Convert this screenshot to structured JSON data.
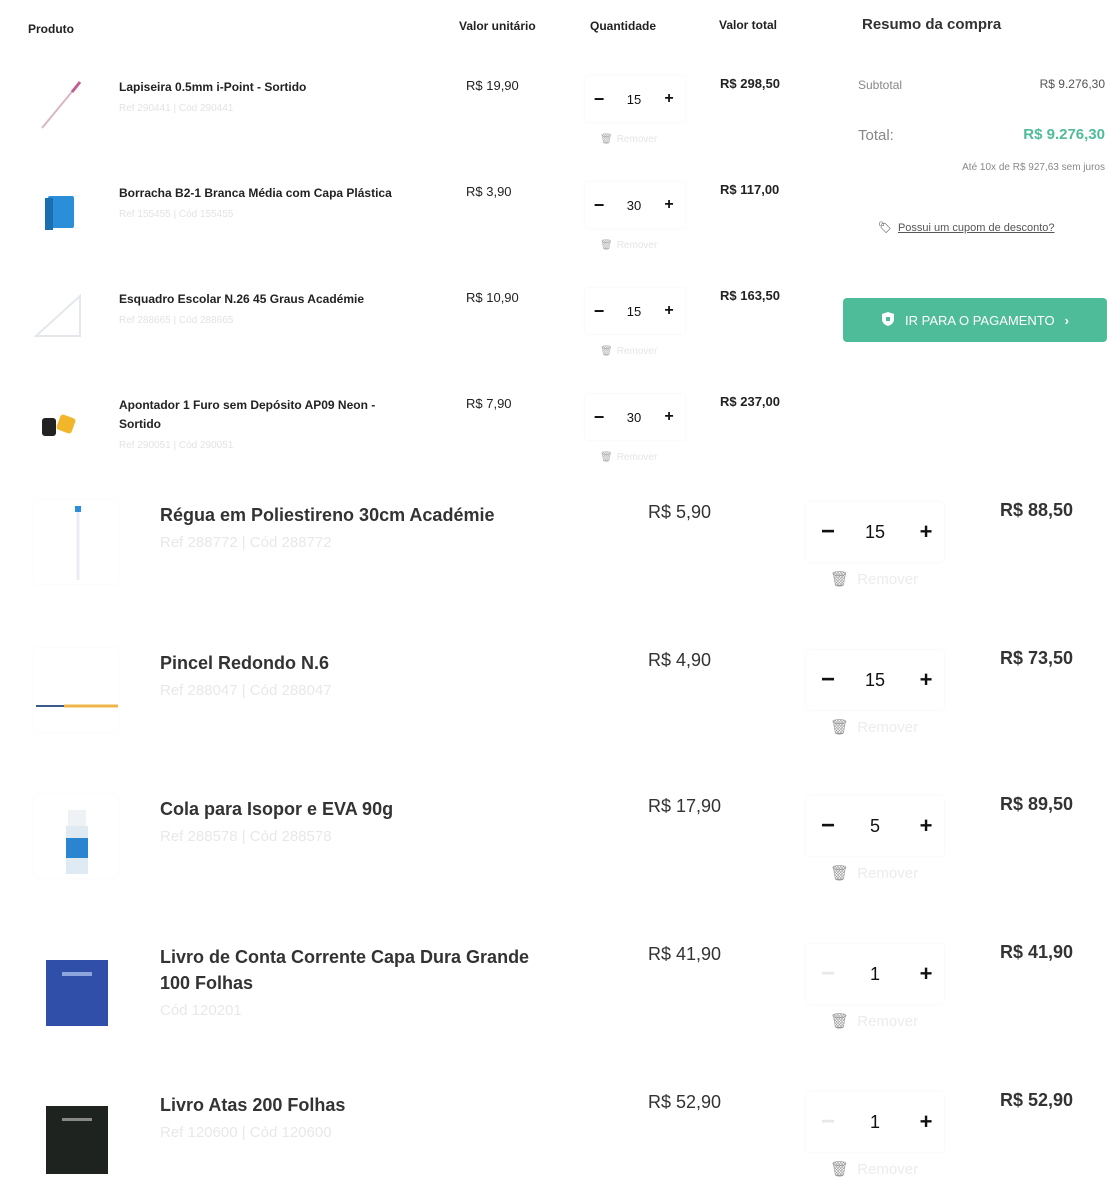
{
  "header": {
    "produto": "Produto",
    "valor_unitario": "Valor unitário",
    "quantidade": "Quantidade",
    "valor_total": "Valor total"
  },
  "summary": {
    "title": "Resumo da compra",
    "subtotal_label": "Subtotal",
    "subtotal_value": "R$ 9.276,30",
    "total_label": "Total:",
    "total_value": "R$ 9.276,30",
    "installments": "Até 10x de R$ 927,63 sem juros",
    "coupon_link": "Possui um cupom de desconto?",
    "pay_button": "IR PARA O PAGAMENTO",
    "accent_color": "#4fbc99"
  },
  "remove_label": "Remover",
  "items_small": [
    {
      "name": "Lapiseira 0.5mm i-Point - Sortido",
      "ref": "Ref 290441  |  Cód 290441",
      "unit": "R$ 19,90",
      "qty": "15",
      "total": "R$ 298,50"
    },
    {
      "name": "Borracha B2-1 Branca Média com Capa Plástica",
      "ref": "Ref 155455  |  Cód 155455",
      "unit": "R$ 3,90",
      "qty": "30",
      "total": "R$ 117,00"
    },
    {
      "name": "Esquadro Escolar N.26 45 Graus Académie",
      "ref": "Ref 288665  |  Cód 288665",
      "unit": "R$ 10,90",
      "qty": "15",
      "total": "R$ 163,50"
    },
    {
      "name": "Apontador 1 Furo sem Depósito AP09 Neon - Sortido",
      "ref": "Ref 290051  |  Cód 290051",
      "unit": "R$ 7,90",
      "qty": "30",
      "total": "R$ 237,00"
    }
  ],
  "items_big": [
    {
      "name": "Régua em Poliestireno 30cm Académie",
      "ref": "Ref 288772  |  Cód 288772",
      "unit": "R$ 5,90",
      "qty": "15",
      "total": "R$ 88,50",
      "minus_enabled": true
    },
    {
      "name": "Pincel Redondo N.6",
      "ref": "Ref 288047  |  Cód 288047",
      "unit": "R$ 4,90",
      "qty": "15",
      "total": "R$ 73,50",
      "minus_enabled": true
    },
    {
      "name": "Cola para Isopor e EVA 90g",
      "ref": "Ref 288578  |  Cód 288578",
      "unit": "R$ 17,90",
      "qty": "5",
      "total": "R$ 89,50",
      "minus_enabled": true
    },
    {
      "name": "Livro de Conta Corrente Capa Dura Grande 100 Folhas",
      "ref": "Cód 120201",
      "unit": "R$ 41,90",
      "qty": "1",
      "total": "R$ 41,90",
      "minus_enabled": false
    },
    {
      "name": "Livro Atas 200 Folhas",
      "ref": "Ref 120600  |  Cód 120600",
      "unit": "R$ 52,90",
      "qty": "1",
      "total": "R$ 52,90",
      "minus_enabled": false
    }
  ]
}
